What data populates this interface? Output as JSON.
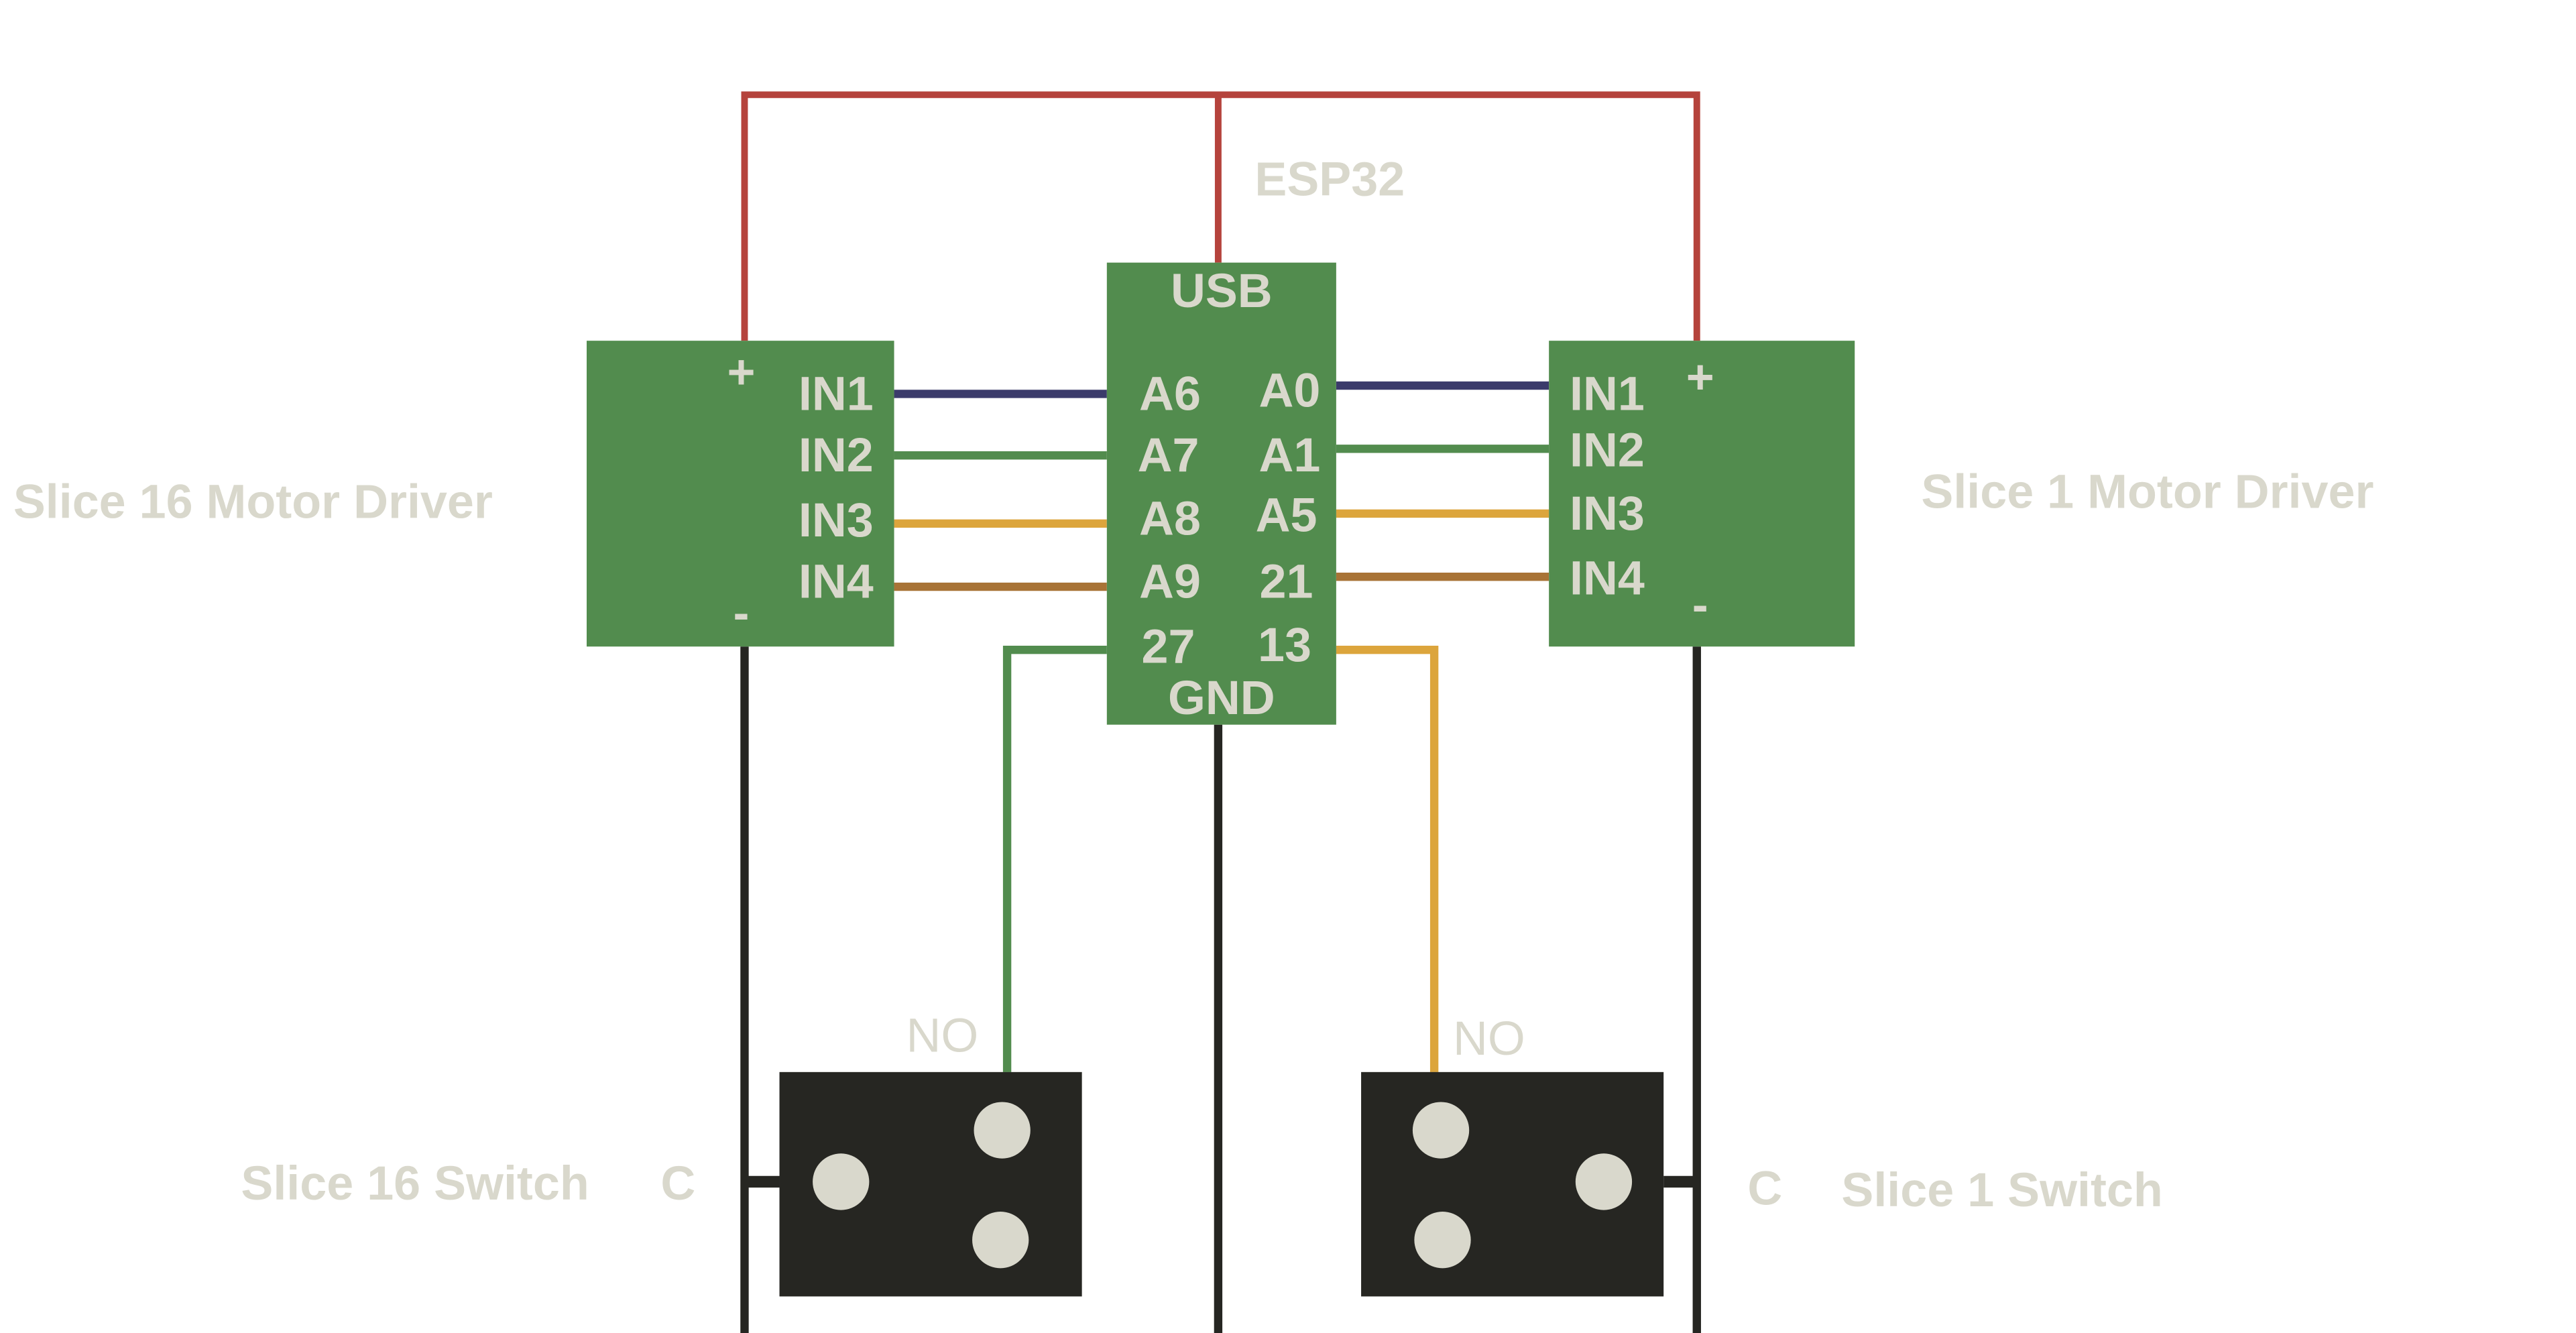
{
  "colors": {
    "board": "#528c4e",
    "switch_body": "#262622",
    "text": "#d9d8cc",
    "power_wire": "#b5433c",
    "ground_wire": "#262622",
    "in1_wire": "#3b3b6b",
    "in2_wire": "#528c4e",
    "in3_wire": "#dca53c",
    "in4_wire": "#a87336"
  },
  "esp32": {
    "title": "ESP32",
    "usb": "USB",
    "gnd": "GND",
    "left_pins": [
      "A6",
      "A7",
      "A8",
      "A9",
      "27"
    ],
    "right_pins": [
      "A0",
      "A1",
      "A5",
      "21",
      "13"
    ]
  },
  "left_driver": {
    "title": "Slice 16 Motor Driver",
    "plus": "+",
    "minus": "-",
    "pins": [
      "IN1",
      "IN2",
      "IN3",
      "IN4"
    ]
  },
  "right_driver": {
    "title": "Slice 1 Motor Driver",
    "plus": "+",
    "minus": "-",
    "pins": [
      "IN1",
      "IN2",
      "IN3",
      "IN4"
    ]
  },
  "left_switch": {
    "title": "Slice 16 Switch",
    "common": "C",
    "normally_open": "NO"
  },
  "right_switch": {
    "title": "Slice 1 Switch",
    "common": "C",
    "normally_open": "NO"
  }
}
